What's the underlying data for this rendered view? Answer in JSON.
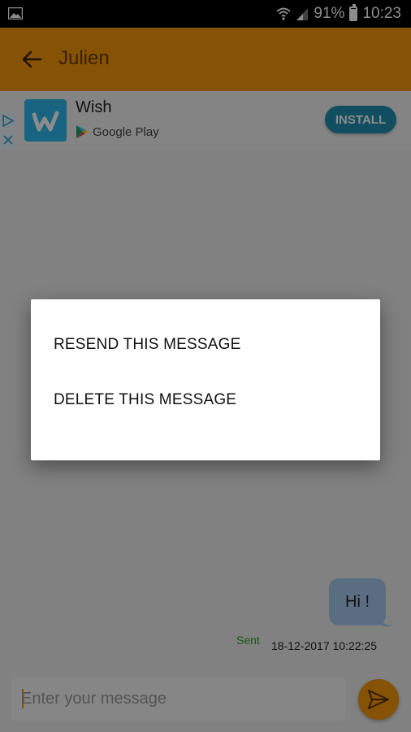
{
  "status_bar": {
    "battery": "91%",
    "battery_level_percent": 91,
    "time": "10:23",
    "icons": [
      "gallery-icon",
      "wifi-icon",
      "signal-icon",
      "battery-icon"
    ]
  },
  "app_bar": {
    "back_icon": "arrow-left-icon",
    "title": "Julien"
  },
  "ad_banner": {
    "app_name": "Wish",
    "store": "Google Play",
    "install_label": "INSTALL",
    "icons": [
      "ad-choices-icon",
      "wish-logo-icon",
      "google-play-icon"
    ]
  },
  "conversation": {
    "message_text": "Hi !",
    "status": "Sent",
    "timestamp": "18-12-2017 10:22:25"
  },
  "composer": {
    "placeholder": "Enter your message",
    "send_icon": "send-icon"
  },
  "dialog": {
    "options": [
      "RESEND THIS MESSAGE",
      "DELETE THIS MESSAGE"
    ]
  },
  "colors": {
    "accent": "#f5960a",
    "bubble": "#a6c8ec",
    "install_button": "#1f8fb0",
    "sent_status": "#2e9e2e"
  }
}
